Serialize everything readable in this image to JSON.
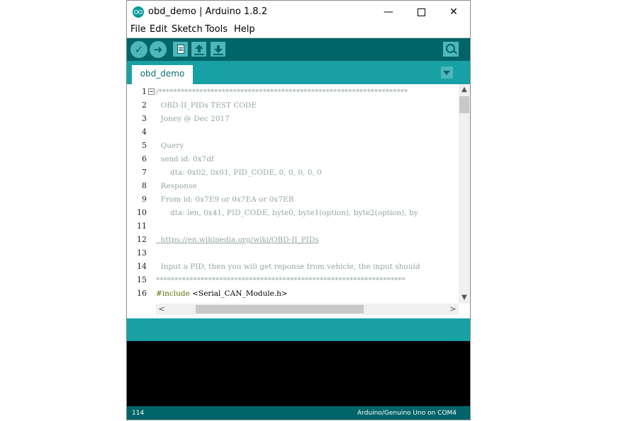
{
  "window": {
    "title": "obd_demo | Arduino 1.8.2",
    "controls": {
      "minimize": "—",
      "close": "✕"
    }
  },
  "menu": [
    "File",
    "Edit",
    "Sketch",
    "Tools",
    "Help"
  ],
  "toolbar": {
    "verify_icon": "checkmark-icon",
    "upload_icon": "arrow-right-icon",
    "new_icon": "document-icon",
    "open_icon": "arrow-up-icon",
    "save_icon": "arrow-down-icon",
    "monitor_icon": "magnifier-icon",
    "verify_glyph": "✓",
    "upload_glyph": "➜"
  },
  "tabs": [
    {
      "label": "obd_demo",
      "active": true
    }
  ],
  "editor": {
    "line_numbers": [
      "1",
      "2",
      "3",
      "4",
      "5",
      "6",
      "7",
      "8",
      "9",
      "10",
      "11",
      "12",
      "13",
      "14",
      "15",
      "16"
    ],
    "lines": [
      "/*******************************************************************",
      "  OBD-II_PIDs TEST CODE",
      "  Joney @ Dec 2017",
      "",
      "  Query",
      "  send id: 0x7df",
      "      dta: 0x02, 0x01, PID_CODE, 0, 0, 0, 0, 0",
      "  Response",
      "  From id: 0x7E9 or 0x7EA or 0x7EB",
      "      dta: len, 0x41, PID_CODE, byte0, byte1(option), byte2(option), by",
      "",
      "  https://en.wikipedia.org/wiki/OBD-II_PIDs",
      "",
      "  Input a PID, then you will get reponse from vehicle, the input should",
      "*******************************************************************",
      "#include <Serial_CAN_Module.h>"
    ],
    "include_keyword": "#include",
    "include_arg": " <Serial_CAN_Module.h>"
  },
  "scrollbars": {
    "up": "▲",
    "down": "▼",
    "left": "<",
    "right": ">"
  },
  "status": {
    "line": "114",
    "board": "Arduino/Genuino Uno on COM4"
  },
  "colors": {
    "arduino_teal": "#00979c",
    "toolbar_dark": "#006468",
    "tab_bar": "#17a1a5",
    "comment_gray": "#95a5a6",
    "keyword_olive": "#5e6d03"
  }
}
